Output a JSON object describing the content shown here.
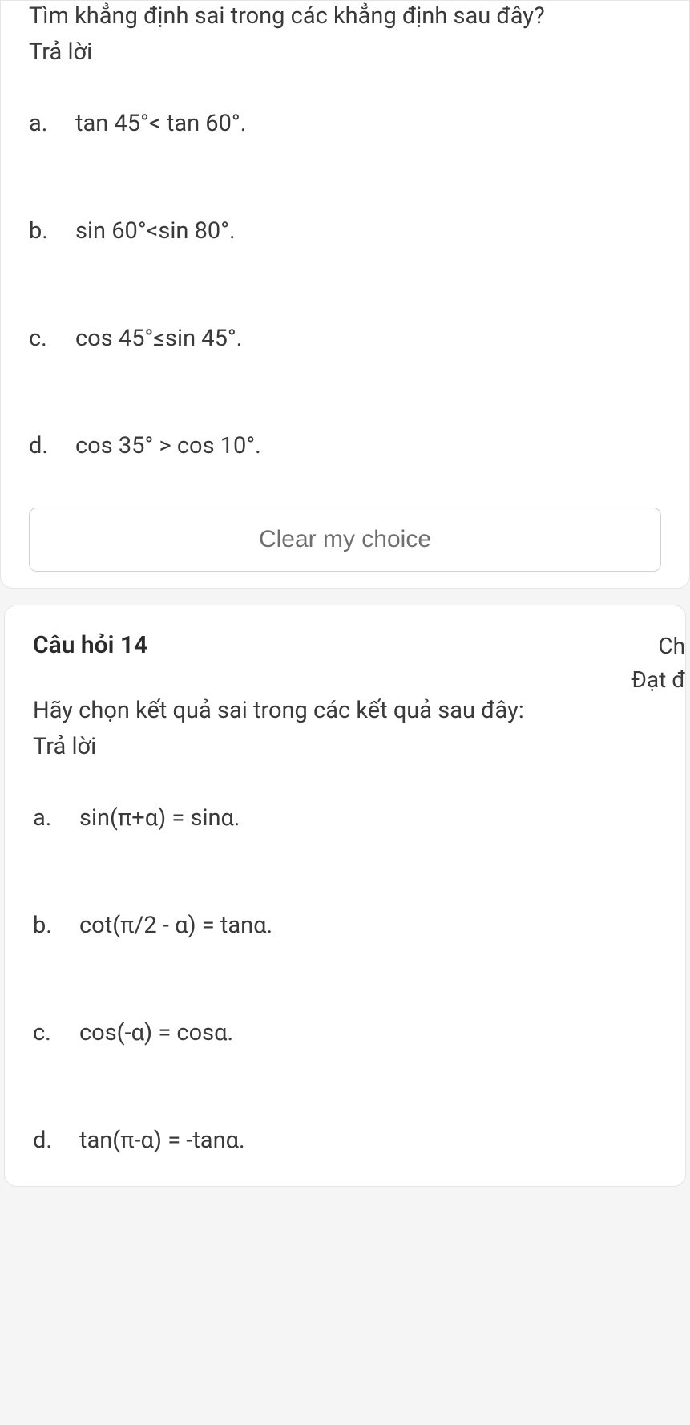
{
  "question13": {
    "prompt": "Tìm khẳng định sai trong các khẳng định sau đây?",
    "answer_label": "Trả lời",
    "options": [
      {
        "letter": "a.",
        "text": "tan 45°< tan 60°."
      },
      {
        "letter": "b.",
        "text": "sin 60°<sin 80°."
      },
      {
        "letter": "c.",
        "text": "cos 45°≤sin 45°."
      },
      {
        "letter": "d.",
        "text": "cos 35° > cos 10°."
      }
    ],
    "clear_button": "Clear my choice"
  },
  "question14": {
    "title": "Câu hỏi 14",
    "status_line1": "Ch",
    "status_line2": "Đạt đ",
    "prompt": "Hãy chọn kết quả sai trong các kết quả sau đây:",
    "answer_label": "Trả lời",
    "options": [
      {
        "letter": "a.",
        "text": "sin(π+α) = sinα."
      },
      {
        "letter": "b.",
        "text": "cot(π/2 - α) = tanα."
      },
      {
        "letter": "c.",
        "text": "cos(-α) = cosα."
      },
      {
        "letter": "d.",
        "text": "tan(π-α) = -tanα."
      }
    ]
  }
}
